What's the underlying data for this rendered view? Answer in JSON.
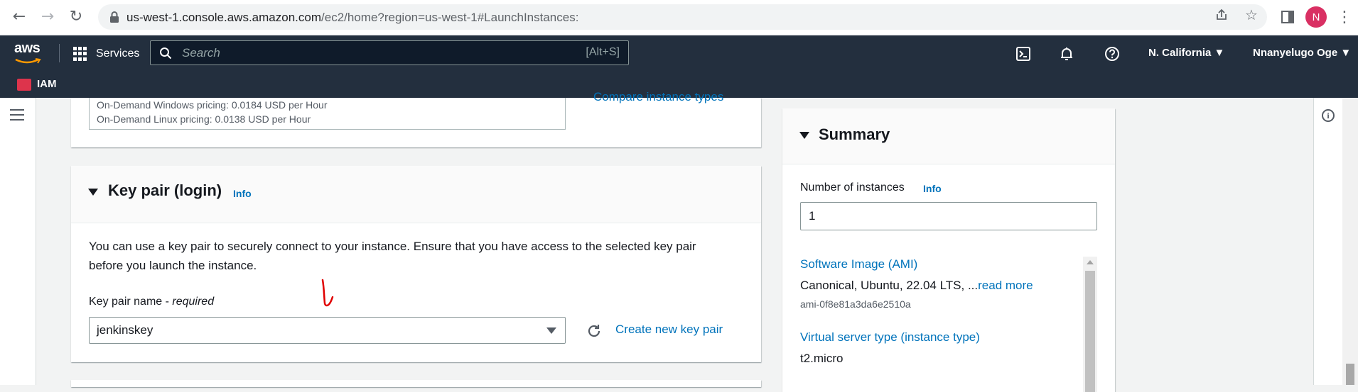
{
  "browser": {
    "url_host": "us-west-1.console.aws.amazon.com",
    "url_rest": "/ec2/home?region=us-west-1#LaunchInstances:",
    "avatar_initial": "N"
  },
  "aws_nav": {
    "logo_text": "aws",
    "services_label": "Services",
    "search_placeholder": "Search",
    "search_shortcut": "[Alt+S]",
    "region_label": "N. California",
    "user_label": "Nnanyelugo Oge"
  },
  "favorites": {
    "iam_label": "IAM"
  },
  "instance_type": {
    "windows_pricing": "On-Demand Windows pricing: 0.0184 USD per Hour",
    "linux_pricing": "On-Demand Linux pricing: 0.0138 USD per Hour",
    "compare_link": "Compare instance types"
  },
  "key_pair": {
    "title": "Key pair (login)",
    "info": "Info",
    "description": "You can use a key pair to securely connect to your instance. Ensure that you have access to the selected key pair before you launch the instance.",
    "name_label": "Key pair name - ",
    "name_required": "required",
    "selected_value": "jenkinskey",
    "create_link": "Create new key pair"
  },
  "summary": {
    "title": "Summary",
    "instances_label": "Number of instances",
    "info": "Info",
    "instances_value": "1",
    "ami_heading": "Software Image (AMI)",
    "ami_text": "Canonical, Ubuntu, 22.04 LTS, ...",
    "ami_read_more": "read more",
    "ami_id": "ami-0f8e81a3da6e2510a",
    "server_type_heading": "Virtual server type (instance type)",
    "server_type_value": "t2.micro"
  },
  "colors": {
    "aws_nav_bg": "#232f3e",
    "link": "#0073bb",
    "annotation": "#e00000"
  }
}
